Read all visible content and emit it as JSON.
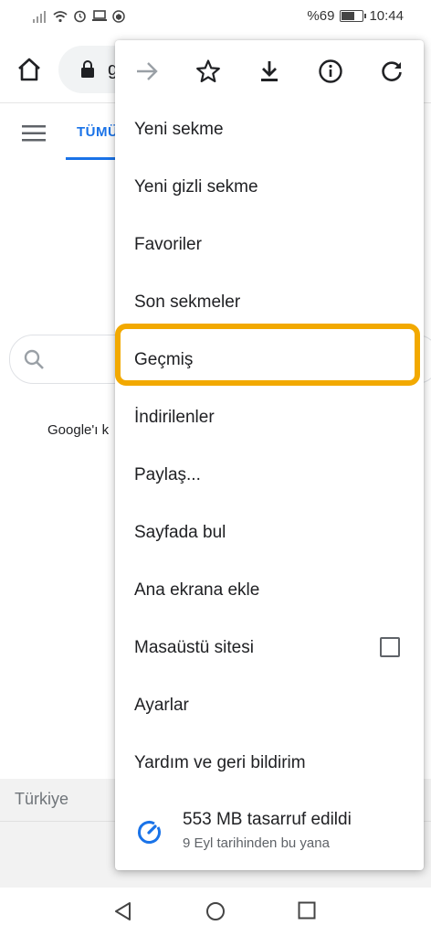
{
  "status_bar": {
    "battery_text": "%69",
    "time": "10:44",
    "battery_level": 0.69
  },
  "toolbar": {
    "url_partial": "g"
  },
  "page": {
    "tab_all": "TÜMÜ",
    "google_text": "Google'ı k",
    "footer_country": "Türkiye"
  },
  "menu": {
    "items": [
      "Yeni sekme",
      "Yeni gizli sekme",
      "Favoriler",
      "Son sekmeler",
      "Geçmiş",
      "İndirilenler",
      "Paylaş...",
      "Sayfada bul",
      "Ana ekrana ekle",
      "Masaüstü sitesi",
      "Ayarlar",
      "Yardım ve geri bildirim"
    ],
    "desktop_site_checked": false,
    "saver": {
      "title": "553 MB tasarruf edildi",
      "subtitle": "9 Eyl tarihinden bu yana"
    }
  },
  "colors": {
    "highlight": "#f2a900",
    "accent": "#1a73e8"
  }
}
